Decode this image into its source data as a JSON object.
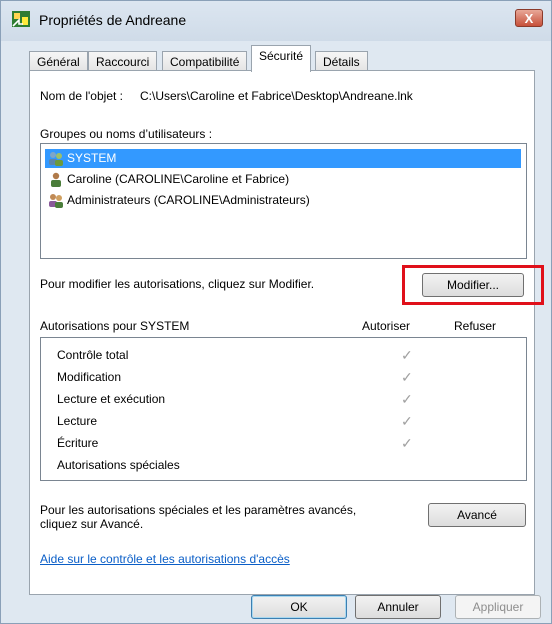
{
  "window": {
    "title": "Propriétés de Andreane",
    "close_label": "X"
  },
  "tabs": [
    {
      "label": "Général"
    },
    {
      "label": "Raccourci"
    },
    {
      "label": "Compatibilité"
    },
    {
      "label": "Sécurité",
      "active": true
    },
    {
      "label": "Détails"
    }
  ],
  "object_name": {
    "label": "Nom de l'objet :",
    "value": "C:\\Users\\Caroline et Fabrice\\Desktop\\Andreane.lnk"
  },
  "groups": {
    "label": "Groupes ou noms d’utilisateurs :",
    "items": [
      {
        "name": "SYSTEM",
        "icon": "group-users-icon",
        "selected": true
      },
      {
        "name": "Caroline (CAROLINE\\Caroline et Fabrice)",
        "icon": "user-icon",
        "selected": false
      },
      {
        "name": "Administrateurs (CAROLINE\\Administrateurs)",
        "icon": "group-users-icon",
        "selected": false
      }
    ]
  },
  "modify": {
    "hint": "Pour modifier les autorisations, cliquez sur Modifier.",
    "button": "Modifier..."
  },
  "permissions": {
    "header": "Autorisations pour SYSTEM",
    "allow_col": "Autoriser",
    "deny_col": "Refuser",
    "rows": [
      {
        "name": "Contrôle total",
        "allow": true
      },
      {
        "name": "Modification",
        "allow": true
      },
      {
        "name": "Lecture et exécution",
        "allow": true
      },
      {
        "name": "Lecture",
        "allow": true
      },
      {
        "name": "Écriture",
        "allow": true
      },
      {
        "name": "Autorisations spéciales",
        "allow": false
      }
    ]
  },
  "advanced": {
    "hint_line1": "Pour les autorisations spéciales et les paramètres avancés,",
    "hint_line2": "cliquez sur Avancé.",
    "button": "Avancé"
  },
  "help_link": "Aide sur le contrôle et les autorisations d'accès",
  "footer": {
    "ok": "OK",
    "cancel": "Annuler",
    "apply": "Appliquer"
  },
  "colors": {
    "selection": "#3399ff",
    "highlight_box": "#e0101a",
    "link": "#0a5ec7"
  }
}
